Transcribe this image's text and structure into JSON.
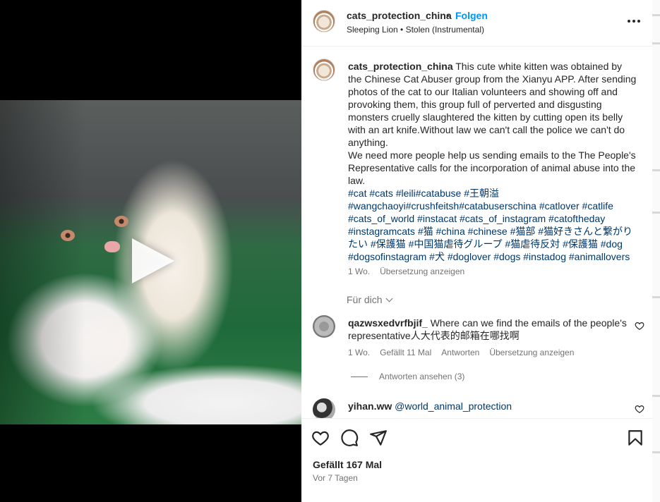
{
  "post": {
    "username": "cats_protection_china",
    "follow_label": "Folgen",
    "audio": "Sleeping Lion • Stolen (Instrumental)",
    "caption_text": "This cute white kitten was obtained by the Chinese Cat Abuser group from the Xianyu APP. After sending photos of the cat to our Italian volunteers and showing off and provoking them, this group full of perverted and disgusting monsters cruelly slaughtered the kitten by cutting open its belly with an art knife.Without law we can't call the police we can't do anything.",
    "caption_text2": "We need more people help us sending emails to the The People's Representative calls for the incorporation of animal abuse into the law.",
    "hashtags": "#cat #cats #leili#catabuse #王朝溢 #wangchaoyi#crushfeitsh#catabuserschina #catlover #catlife #cats_of_world #instacat #cats_of_instagram #catoftheday #instagramcats #猫 #china #chinese #猫部 #猫好きさんと繋がりたい #保護猫 #中国猫虐待グループ #猫虐待反対 #保護猫 #dog #dogsofinstagram #犬 #doglover #dogs #instadog #animallovers",
    "caption_age": "1 Wo.",
    "translate_label": "Übersetzung anzeigen",
    "for_you_label": "Für dich",
    "likes_label": "Gefällt 167 Mal",
    "posted_ago": "Vor 7 Tagen"
  },
  "comments": [
    {
      "username": "qazwsxedvrfbjif_",
      "text": "Where can we find the emails of the people's representative人大代表的邮箱在哪找啊",
      "age": "1 Wo.",
      "likes": "Gefällt 11 Mal",
      "reply_label": "Antworten",
      "translate_label": "Übersetzung anzeigen",
      "view_replies": "Antworten ansehen (3)"
    },
    {
      "username": "yihan.ww",
      "mention": "@world_animal_protection"
    }
  ],
  "icons": {
    "like": "heart-icon",
    "comment": "comment-icon",
    "share": "share-icon",
    "save": "bookmark-icon",
    "more": "more-options-icon",
    "play": "play-icon"
  },
  "colors": {
    "link_blue": "#0095f6",
    "hashtag": "#00376b",
    "muted": "#737373"
  }
}
